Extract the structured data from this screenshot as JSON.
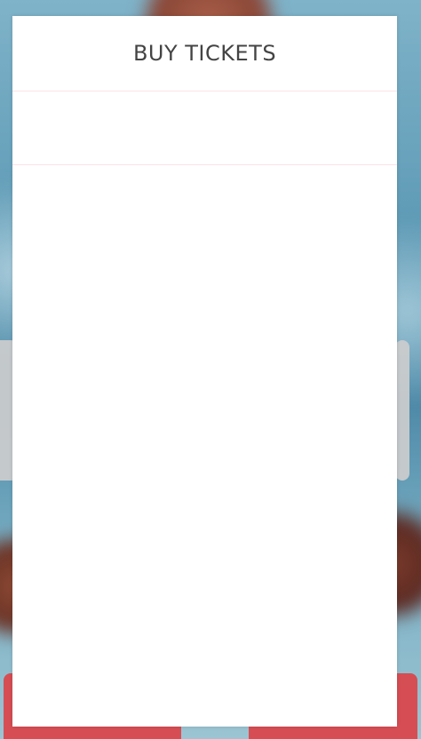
{
  "modal": {
    "title": "BUY TICKETS"
  }
}
